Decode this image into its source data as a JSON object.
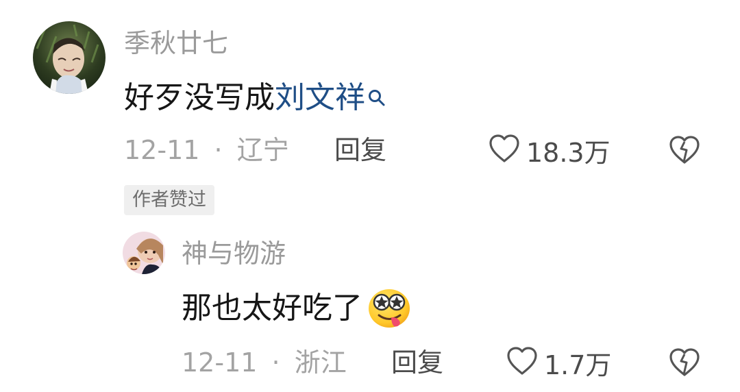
{
  "comments": [
    {
      "username": "季秋廿七",
      "content_text": "好歹没写成",
      "content_link": "刘文祥",
      "date": "12-11",
      "separator": "·",
      "location": "辽宁",
      "reply_label": "回复",
      "like_count": "18.3万",
      "author_tag": "作者赞过",
      "icons": {
        "search": "search-icon",
        "like": "heart-icon",
        "dislike": "broken-heart-icon"
      }
    },
    {
      "username": "神与物游",
      "content_text": "那也太好吃了",
      "emoji": "drooling-star-eyes-emoji",
      "date": "12-11",
      "separator": "·",
      "location": "浙江",
      "reply_label": "回复",
      "like_count": "1.7万",
      "icons": {
        "like": "heart-icon",
        "dislike": "broken-heart-icon"
      }
    }
  ],
  "colors": {
    "username": "#9a9a9a",
    "link": "#1f4e86",
    "meta": "#a3a3a3",
    "action": "#4b4b4b",
    "tag_bg": "#efefef"
  }
}
